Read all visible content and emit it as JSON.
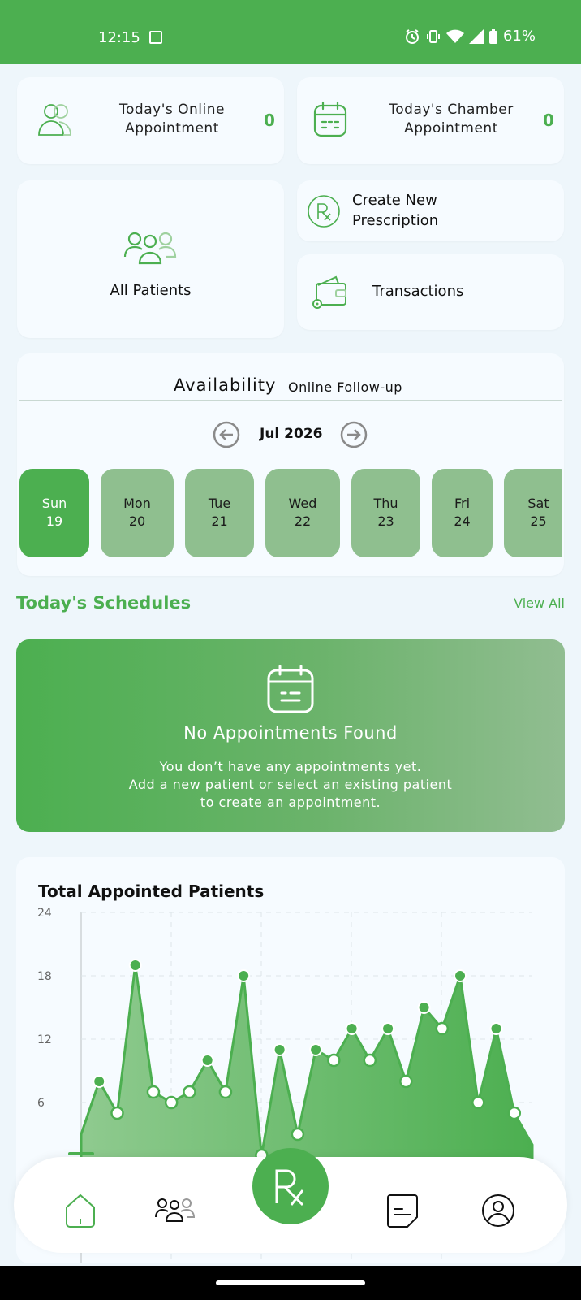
{
  "status_bar": {
    "time": "12:15",
    "battery": "61%"
  },
  "stats": {
    "online": {
      "title": "Today's Online Appointment",
      "value": "0"
    },
    "chamber": {
      "title": "Today's Chamber Appointment",
      "value": "0"
    }
  },
  "quick": {
    "all_patients": "All Patients",
    "create_prescription": "Create New Prescription",
    "transactions": "Transactions"
  },
  "availability": {
    "title": "Availability",
    "subtitle": "Online Follow-up",
    "month": "Jul 2026",
    "days": [
      {
        "name": "Sun",
        "num": "19",
        "active": true
      },
      {
        "name": "Mon",
        "num": "20"
      },
      {
        "name": "Tue",
        "num": "21"
      },
      {
        "name": "Wed",
        "num": "22"
      },
      {
        "name": "Thu",
        "num": "23"
      },
      {
        "name": "Fri",
        "num": "24"
      },
      {
        "name": "Sat",
        "num": "25"
      }
    ]
  },
  "schedules": {
    "title": "Today's Schedules",
    "view_all": "View All",
    "empty_title": "No Appointments Found",
    "empty_line1": "You don’t have any appointments yet.",
    "empty_line2": "Add a new patient or select an existing patient",
    "empty_line3": "to create an appointment."
  },
  "chart_data": {
    "type": "area",
    "title": "Total Appointed Patients",
    "y_ticks": [
      "24",
      "18",
      "12",
      "6"
    ],
    "ylim": [
      0,
      24
    ],
    "grid": true,
    "series": [
      {
        "values": [
          3,
          8,
          5,
          19,
          7,
          6,
          7,
          10,
          7,
          18,
          1,
          11,
          3,
          11,
          10,
          13,
          10,
          13,
          8,
          15,
          13,
          18,
          6,
          13,
          5,
          2
        ]
      }
    ],
    "colors": {
      "fill_start": "#8fca8f",
      "fill_end": "#4caf50",
      "line": "#4caf50"
    }
  },
  "colors": {
    "accent": "#4caf50",
    "day_inactive": "#8fbf8f"
  }
}
